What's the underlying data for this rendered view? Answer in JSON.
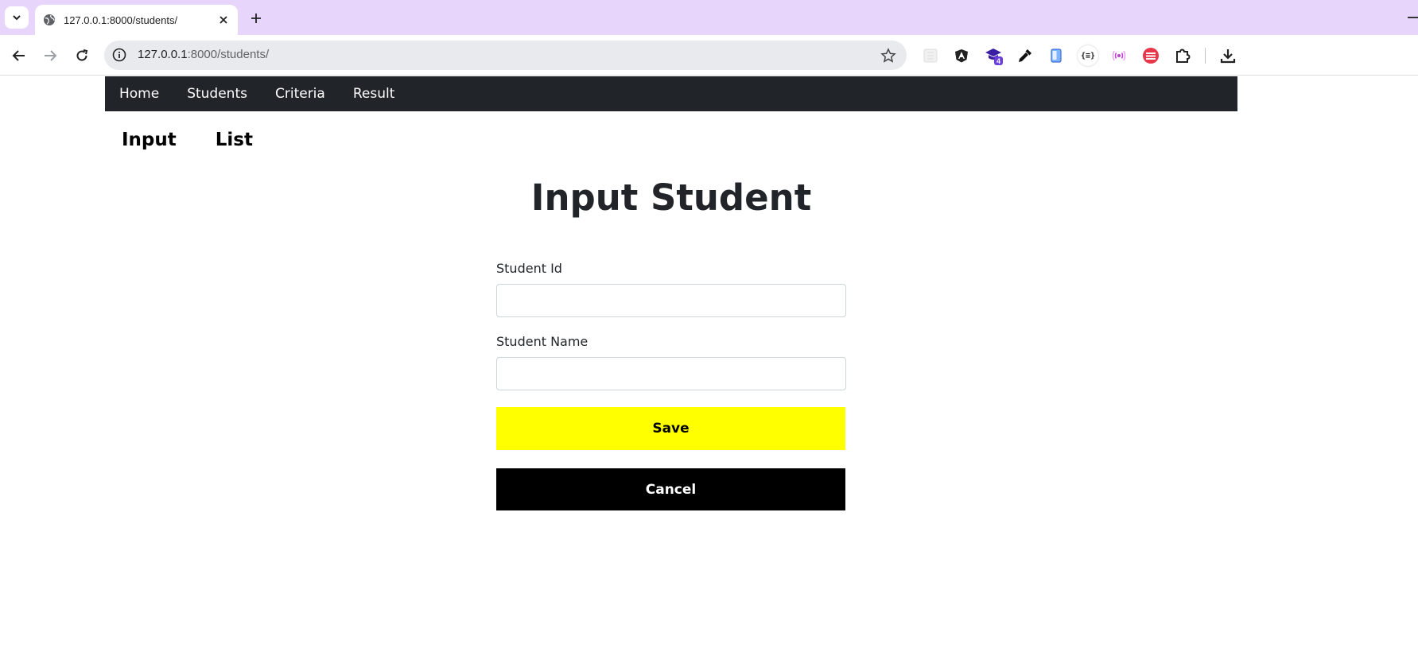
{
  "browser": {
    "tab": {
      "title": "127.0.0.1:8000/students/"
    },
    "address": {
      "host": "127.0.0.1",
      "path": ":8000/students/"
    },
    "extensions": [
      {
        "name": "grid-ext-icon"
      },
      {
        "name": "angular-ext-icon"
      },
      {
        "name": "graduation-cap-ext-icon",
        "badge": "4"
      },
      {
        "name": "eyedropper-ext-icon"
      },
      {
        "name": "phone-ext-icon"
      },
      {
        "name": "json-ext-icon",
        "text": "{≡}"
      },
      {
        "name": "radio-ext-icon"
      },
      {
        "name": "red-circle-ext-icon"
      },
      {
        "name": "puzzle-ext-icon"
      },
      {
        "name": "download-icon"
      }
    ]
  },
  "navbar": {
    "items": [
      {
        "label": "Home"
      },
      {
        "label": "Students"
      },
      {
        "label": "Criteria"
      },
      {
        "label": "Result"
      }
    ]
  },
  "subnav": {
    "items": [
      {
        "label": "Input"
      },
      {
        "label": "List"
      }
    ]
  },
  "main": {
    "title": "Input Student",
    "fields": [
      {
        "label": "Student Id",
        "value": ""
      },
      {
        "label": "Student Name",
        "value": ""
      }
    ],
    "save_label": "Save",
    "cancel_label": "Cancel"
  },
  "colors": {
    "navbar_bg": "#212529",
    "save_bg": "#ffff00",
    "cancel_bg": "#000000",
    "tabbar_bg": "#e8d5fb"
  }
}
